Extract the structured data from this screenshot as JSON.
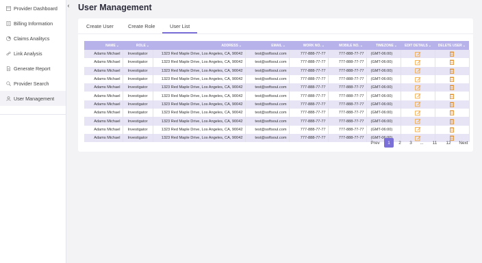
{
  "sidebar": {
    "items": [
      {
        "label": "Provider Dashboard",
        "icon": "dashboard-icon"
      },
      {
        "label": "Billing Information",
        "icon": "billing-icon"
      },
      {
        "label": "Claims Analitycs",
        "icon": "pie-chart-icon"
      },
      {
        "label": "Link Analysis",
        "icon": "link-icon"
      },
      {
        "label": "Generate Report",
        "icon": "report-icon"
      },
      {
        "label": "Provider Search",
        "icon": "search-icon"
      },
      {
        "label": "User Management",
        "icon": "user-icon"
      }
    ],
    "active_index": 6
  },
  "page": {
    "title": "User Management"
  },
  "tabs": [
    {
      "label": "Create User"
    },
    {
      "label": "Create Role"
    },
    {
      "label": "User List"
    }
  ],
  "active_tab": 2,
  "table": {
    "columns": [
      "NAME",
      "ROLE",
      "ADDRESS",
      "EMAIL",
      "WORK NO.",
      "MOBILE NO.",
      "TIMEZONE",
      "EDIT DETAILS",
      "DELETE USER"
    ],
    "rows": [
      [
        "Adams Michael",
        "Investigator",
        "1323 Red Maple Drive, Los Angeles, CA, 90042",
        "test@softsoul.com",
        "777-888-77-77",
        "777-888-77-77",
        "(GMT-06:00)"
      ],
      [
        "Adams Michael",
        "Investigator",
        "1323 Red Maple Drive, Los Angeles, CA, 90042",
        "test@softsoul.com",
        "777-888-77-77",
        "777-888-77-77",
        "(GMT-06:00)"
      ],
      [
        "Adams Michael",
        "Investigator",
        "1323 Red Maple Drive, Los Angeles, CA, 90042",
        "test@softsoul.com",
        "777-888-77-77",
        "777-888-77-77",
        "(GMT-06:00)"
      ],
      [
        "Adams Michael",
        "Investigator",
        "1323 Red Maple Drive, Los Angeles, CA, 90042",
        "test@softsoul.com",
        "777-888-77-77",
        "777-888-77-77",
        "(GMT-06:00)"
      ],
      [
        "Adams Michael",
        "Investigator",
        "1323 Red Maple Drive, Los Angeles, CA, 90042",
        "test@softsoul.com",
        "777-888-77-77",
        "777-888-77-77",
        "(GMT-06:00)"
      ],
      [
        "Adams Michael",
        "Investigator",
        "1323 Red Maple Drive, Los Angeles, CA, 90042",
        "test@softsoul.com",
        "777-888-77-77",
        "777-888-77-77",
        "(GMT-06:00)"
      ],
      [
        "Adams Michael",
        "Investigator",
        "1323 Red Maple Drive, Los Angeles, CA, 90042",
        "test@softsoul.com",
        "777-888-77-77",
        "777-888-77-77",
        "(GMT-06:00)"
      ],
      [
        "Adams Michael",
        "Investigator",
        "1323 Red Maple Drive, Los Angeles, CA, 90042",
        "test@softsoul.com",
        "777-888-77-77",
        "777-888-77-77",
        "(GMT-06:00)"
      ],
      [
        "Adams Michael",
        "Investigator",
        "1323 Red Maple Drive, Los Angeles, CA, 90042",
        "test@softsoul.com",
        "777-888-77-77",
        "777-888-77-77",
        "(GMT-06:00)"
      ],
      [
        "Adams Michael",
        "Investigator",
        "1323 Red Maple Drive, Los Angeles, CA, 90042",
        "test@softsoul.com",
        "777-888-77-77",
        "777-888-77-77",
        "(GMT-06:00)"
      ],
      [
        "Adams Michael",
        "Investigator",
        "1323 Red Maple Drive, Los Angeles, CA, 90042",
        "test@softsoul.com",
        "777-888-77-77",
        "777-888-77-77",
        "(GMT-06:00)"
      ]
    ]
  },
  "pagination": {
    "prev": "Prev",
    "pages": [
      "1",
      "2",
      "3",
      "...",
      "11",
      "12"
    ],
    "active": "1",
    "next": "Next"
  },
  "colors": {
    "accent": "#7b6fd8",
    "header": "#b8b2ea",
    "row_alt": "#e6e4f5",
    "edit_icon": "#f0a030",
    "delete_icon": "#e08a20"
  }
}
